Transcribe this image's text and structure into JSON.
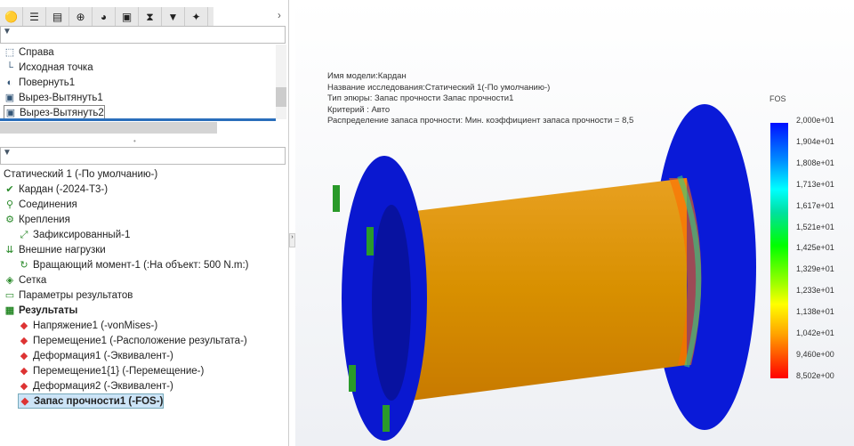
{
  "feature_tree": {
    "items": [
      {
        "label": "Справа",
        "icon": "plane-icon"
      },
      {
        "label": "Исходная точка",
        "icon": "origin-icon"
      },
      {
        "label": "Повернуть1",
        "icon": "revolve-icon"
      },
      {
        "label": "Вырез-Вытянуть1",
        "icon": "cut-extrude-icon"
      },
      {
        "label": "Вырез-Вытянуть2",
        "icon": "cut-extrude-icon"
      }
    ]
  },
  "sim_tree": {
    "items": [
      {
        "label": "Статический 1 (-По умолчанию-)",
        "indent": 0,
        "bold": false
      },
      {
        "label": "Кардан (-2024-T3-)",
        "indent": 0,
        "icon": "part-icon"
      },
      {
        "label": "Соединения",
        "indent": 0,
        "icon": "connections-icon"
      },
      {
        "label": "Крепления",
        "indent": 0,
        "icon": "fixtures-icon"
      },
      {
        "label": "Зафиксированный-1",
        "indent": 1,
        "icon": "fixed-icon"
      },
      {
        "label": "Внешние нагрузки",
        "indent": 0,
        "icon": "loads-icon"
      },
      {
        "label": "Вращающий момент-1 (:На объект: 500 N.m:)",
        "indent": 1,
        "icon": "torque-icon"
      },
      {
        "label": "Сетка",
        "indent": 0,
        "icon": "mesh-icon"
      },
      {
        "label": "Параметры результатов",
        "indent": 0,
        "icon": "result-options-icon"
      },
      {
        "label": "Результаты",
        "indent": 0,
        "bold": true,
        "icon": "results-folder-icon"
      },
      {
        "label": "Напряжение1 (-vonMises-)",
        "indent": 1,
        "icon": "plot-icon"
      },
      {
        "label": "Перемещение1 (-Расположение результата-)",
        "indent": 1,
        "icon": "plot-icon"
      },
      {
        "label": "Деформация1 (-Эквивалент-)",
        "indent": 1,
        "icon": "plot-icon"
      },
      {
        "label": "Перемещение1{1} (-Перемещение-)",
        "indent": 1,
        "icon": "plot-icon"
      },
      {
        "label": "Деформация2 (-Эквивалент-)",
        "indent": 1,
        "icon": "plot-icon"
      },
      {
        "label": "Запас прочности1 (-FOS-)",
        "indent": 1,
        "bold": true,
        "selected": true,
        "icon": "plot-icon"
      }
    ]
  },
  "info": [
    "Имя модели:Кардан",
    "Название исследования:Статический 1(-По умолчанию-)",
    "Тип эпюры: Запас прочности Запас прочности1",
    "Критерий : Авто",
    "Распределение запаса прочности: Мин. коэффициент запаса прочности = 8,5"
  ],
  "legend": {
    "title": "FOS",
    "labels": [
      "2,000e+01",
      "1,904e+01",
      "1,808e+01",
      "1,713e+01",
      "1,617e+01",
      "1,521e+01",
      "1,425e+01",
      "1,329e+01",
      "1,233e+01",
      "1,138e+01",
      "1,042e+01",
      "9,460e+00",
      "8,502e+00"
    ]
  }
}
